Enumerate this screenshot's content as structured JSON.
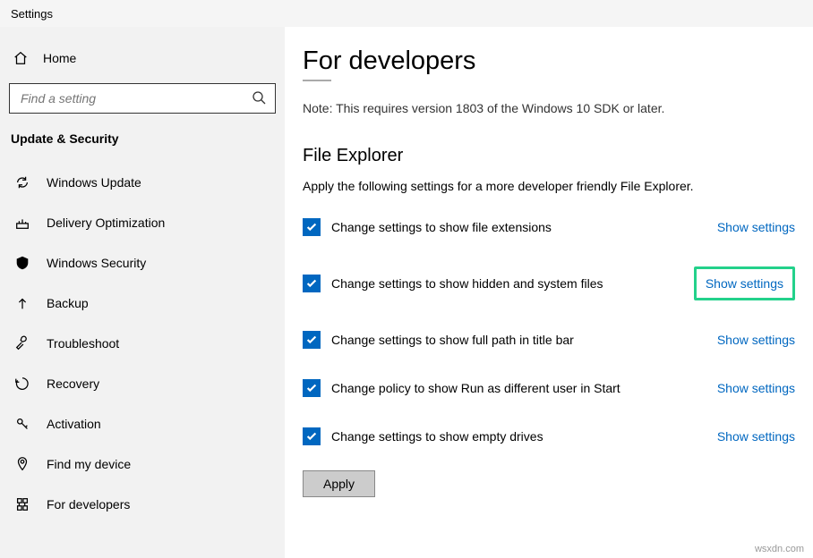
{
  "titlebar": {
    "label": "Settings"
  },
  "sidebar": {
    "home": "Home",
    "search_placeholder": "Find a setting",
    "section": "Update & Security",
    "items": [
      {
        "label": "Windows Update"
      },
      {
        "label": "Delivery Optimization"
      },
      {
        "label": "Windows Security"
      },
      {
        "label": "Backup"
      },
      {
        "label": "Troubleshoot"
      },
      {
        "label": "Recovery"
      },
      {
        "label": "Activation"
      },
      {
        "label": "Find my device"
      },
      {
        "label": "For developers"
      }
    ]
  },
  "main": {
    "title": "For developers",
    "note": "Note: This requires version 1803 of the Windows 10 SDK or later.",
    "section": "File Explorer",
    "desc": "Apply the following settings for a more developer friendly File Explorer.",
    "show_settings": "Show settings",
    "options": [
      {
        "label": "Change settings to show file extensions"
      },
      {
        "label": "Change settings to show hidden and system files"
      },
      {
        "label": "Change settings to show full path in title bar"
      },
      {
        "label": "Change policy to show Run as different user in Start"
      },
      {
        "label": "Change settings to show empty drives"
      }
    ],
    "apply": "Apply"
  },
  "watermark": "wsxdn.com"
}
